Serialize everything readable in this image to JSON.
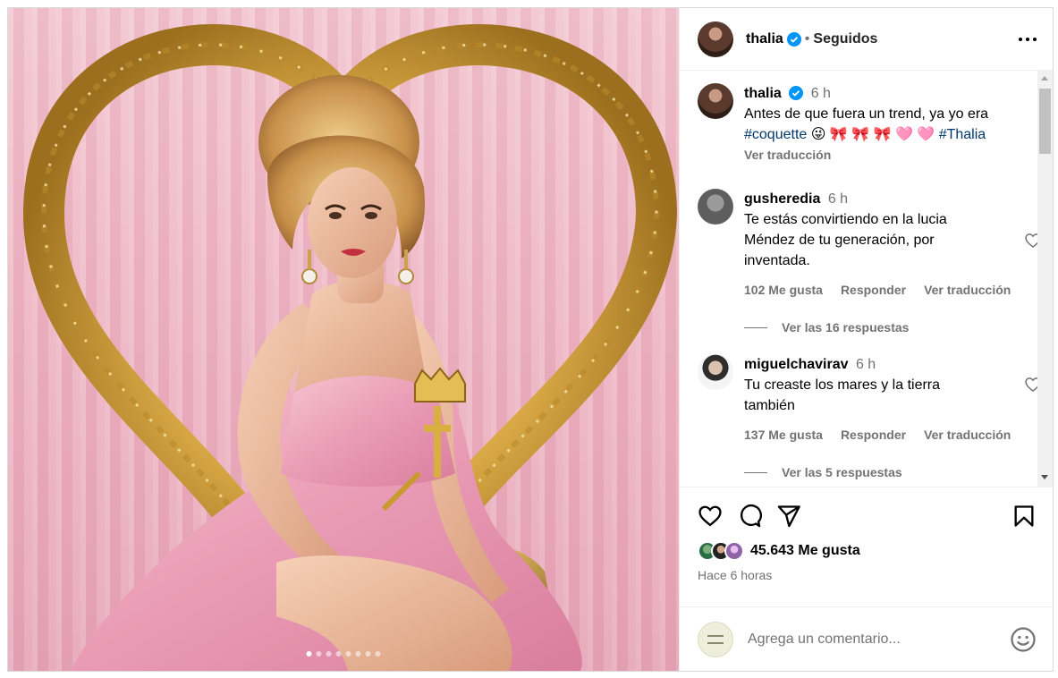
{
  "post": {
    "username": "thalia",
    "separator": "•",
    "follow_status": "Seguidos",
    "carousel_dots": 8,
    "active_dot": 0
  },
  "caption": {
    "username": "thalia",
    "time": "6 h",
    "text_line1": "Antes de que fuera un trend, ya yo era",
    "hashtag1": "#coquette",
    "emojis": "😜 🎀 🎀 🎀 🩷 🩷",
    "hashtag2": "#Thalia",
    "translate": "Ver traducción"
  },
  "comments": [
    {
      "username": "gusheredia",
      "time": "6 h",
      "text": "Te estás convirtiendo en la lucia Méndez de tu generación, por inventada.",
      "likes": "102 Me gusta",
      "reply": "Responder",
      "translate": "Ver traducción",
      "view_replies": "Ver las 16 respuestas"
    },
    {
      "username": "miguelchavirav",
      "time": "6 h",
      "text": "Tu creaste los mares y la tierra también",
      "likes": "137 Me gusta",
      "reply": "Responder",
      "translate": "Ver traducción",
      "view_replies": "Ver las 5 respuestas"
    }
  ],
  "footer": {
    "likes": "45.643 Me gusta",
    "time_ago": "Hace 6 horas",
    "comment_placeholder": "Agrega un comentario..."
  },
  "colors": {
    "verified": "#0095f6",
    "link": "#00376b",
    "secondary_text": "#737373",
    "border": "#dbdbdb"
  }
}
